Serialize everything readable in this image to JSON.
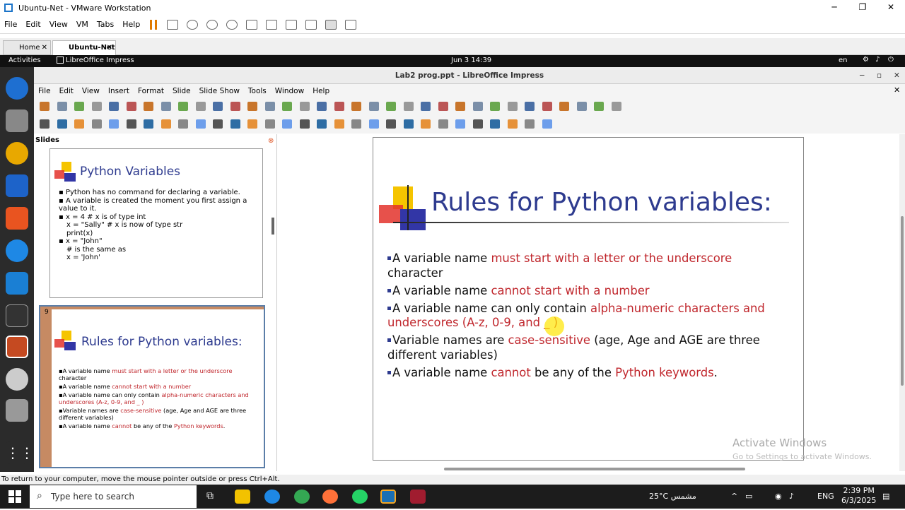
{
  "vmware": {
    "window_title": "Ubuntu-Net - VMware Workstation",
    "menu": [
      "File",
      "Edit",
      "View",
      "VM",
      "Tabs",
      "Help"
    ],
    "tabs": [
      {
        "label": "Home"
      },
      {
        "label": "Ubuntu-Net"
      }
    ],
    "status_text": "To return to your computer, move the mouse pointer outside or press Ctrl+Alt."
  },
  "gnome": {
    "activities": "Activities",
    "app": "LibreOffice Impress",
    "clock": "Jun 3  14:39",
    "lang": "en"
  },
  "impress": {
    "window_title": "Lab2 prog.ppt - LibreOffice Impress",
    "menu": [
      "File",
      "Edit",
      "View",
      "Insert",
      "Format",
      "Slide",
      "Slide Show",
      "Tools",
      "Window",
      "Help"
    ],
    "slides_panel_title": "Slides",
    "thumb8": {
      "title": "Python Variables",
      "lines": [
        "Python has no command for declaring a variable.",
        "A variable is created the moment you first assign a value to it.",
        "x = 4       # x is of type int",
        "x = \"Sally\" # x is now of type str",
        "print(x)",
        "x = \"John\"",
        "# is the same as",
        "x = 'John'"
      ]
    },
    "thumb9": {
      "number": "9",
      "title": "Rules for Python variables:"
    },
    "slide": {
      "title": "Rules for Python variables:",
      "b1a": "A variable name ",
      "b1b": "must start with a letter or the underscore",
      "b1c": " character",
      "b2a": "A variable name ",
      "b2b": "cannot start with a number",
      "b3a": "A variable name can only contain ",
      "b3b": "alpha-numeric characters and underscores (A-z, 0-9, and _ )",
      "b4a": "Variable names are ",
      "b4b": "case-sensitive",
      "b4c": " (age, Age and AGE are three different variables)",
      "b5a": "A variable name ",
      "b5b": "cannot",
      "b5c": " be any of the ",
      "b5d": "Python keywords",
      "b5e": "."
    },
    "watermark1": "Activate Windows",
    "watermark2": "Go to Settings to activate Windows."
  },
  "taskbar": {
    "search_placeholder": "Type here to search",
    "weather": "25°C مشمس",
    "lang": "ENG",
    "time": "2:39 PM",
    "date": "6/3/2025"
  }
}
